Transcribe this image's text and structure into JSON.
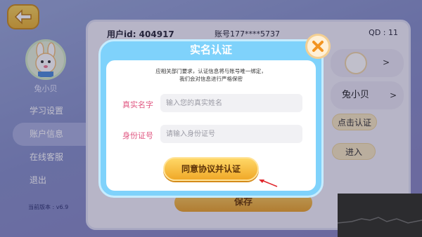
{
  "header": {
    "user_id_label": "用户id: 404917",
    "account_label": "账号177****5737",
    "qd_label": "QD : 11"
  },
  "sidebar": {
    "nickname": "兔小贝",
    "items": [
      {
        "label": "学习设置",
        "active": false
      },
      {
        "label": "账户信息",
        "active": true
      },
      {
        "label": "在线客服",
        "active": false
      },
      {
        "label": "退出",
        "active": false
      }
    ],
    "version": "当前版本 : v6.9"
  },
  "right_panel": {
    "nickname": "兔小贝",
    "verify_label": "点击认证",
    "enter_label": "进入",
    "chevron": ">"
  },
  "underlying_save_label": "保存",
  "modal": {
    "title": "实名认证",
    "notice_line1": "应相关部门要求，认证信息将与账号唯一绑定，",
    "notice_line2": "我们会对信息进行严格保密",
    "name_label": "真实名字",
    "name_placeholder": "输入您的真实姓名",
    "id_label": "身份证号",
    "id_placeholder": "请输入身份证号",
    "confirm_label": "同意协议并认证"
  },
  "colors": {
    "modal_frame": "#7fd2fb",
    "label_pink": "#e05681",
    "button_orange": "#f0a929",
    "arrow_red": "#e0282d"
  }
}
